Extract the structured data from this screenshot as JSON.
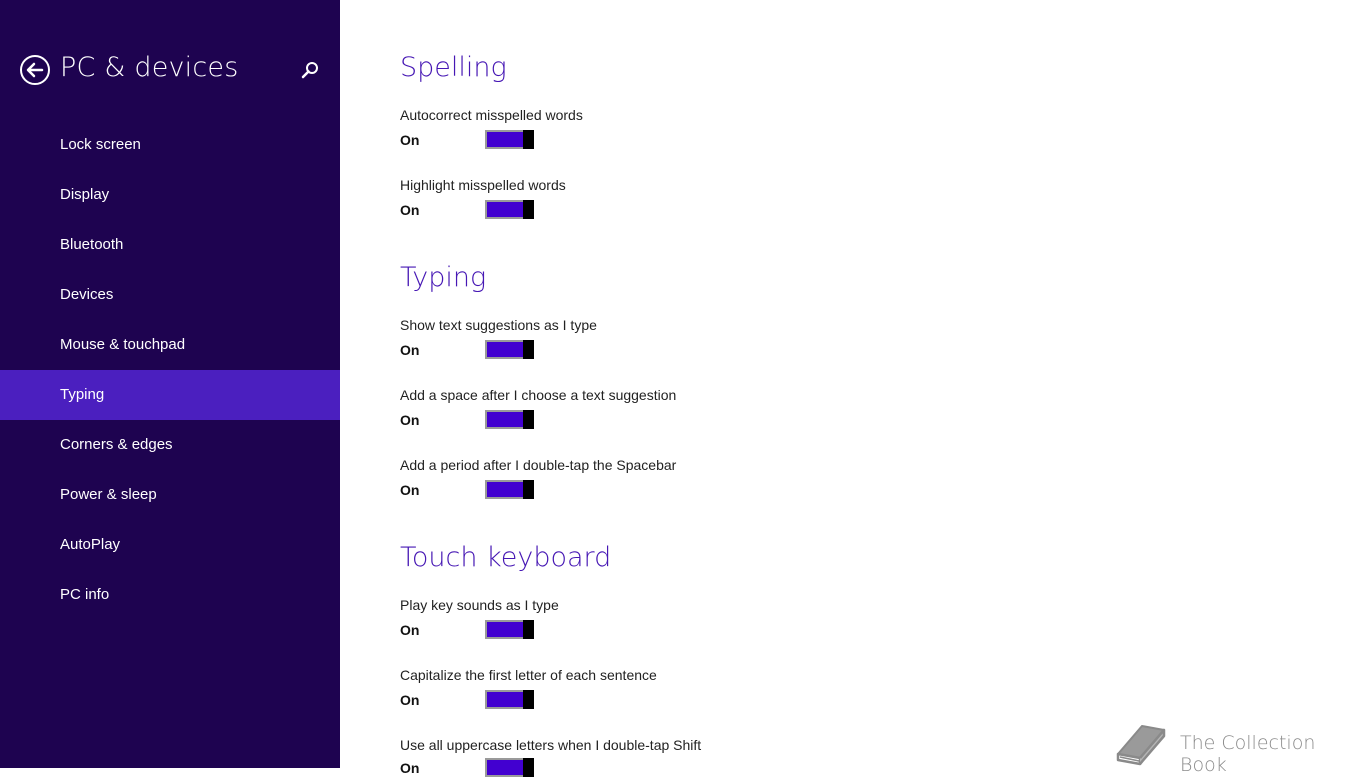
{
  "sidebar": {
    "title": "PC & devices",
    "back_icon": "back-arrow-circle-icon",
    "search_icon": "search-icon",
    "items": [
      {
        "label": "Lock screen"
      },
      {
        "label": "Display"
      },
      {
        "label": "Bluetooth"
      },
      {
        "label": "Devices"
      },
      {
        "label": "Mouse & touchpad"
      },
      {
        "label": "Typing",
        "selected": true
      },
      {
        "label": "Corners & edges"
      },
      {
        "label": "Power & sleep"
      },
      {
        "label": "AutoPlay"
      },
      {
        "label": "PC info"
      }
    ]
  },
  "sections": {
    "spelling": {
      "title": "Spelling",
      "settings": [
        {
          "label": "Autocorrect misspelled words",
          "state": "On"
        },
        {
          "label": "Highlight misspelled words",
          "state": "On"
        }
      ]
    },
    "typing": {
      "title": "Typing",
      "settings": [
        {
          "label": "Show text suggestions as I type",
          "state": "On"
        },
        {
          "label": "Add a space after I choose a text suggestion",
          "state": "On"
        },
        {
          "label": "Add a period after I double-tap the Spacebar",
          "state": "On"
        }
      ]
    },
    "touch_keyboard": {
      "title": "Touch keyboard",
      "settings": [
        {
          "label": "Play key sounds as I type",
          "state": "On"
        },
        {
          "label": "Capitalize the first letter of each sentence",
          "state": "On"
        },
        {
          "label": "Use all uppercase letters when I double-tap Shift",
          "state": "On"
        }
      ]
    }
  },
  "watermark": {
    "text": "The Collection Book",
    "icon": "book-icon"
  },
  "colors": {
    "sidebar_bg": "#1e0350",
    "selected_bg": "#4b1fbf",
    "accent": "#4617b4",
    "toggle_fill": "#4200d0"
  }
}
